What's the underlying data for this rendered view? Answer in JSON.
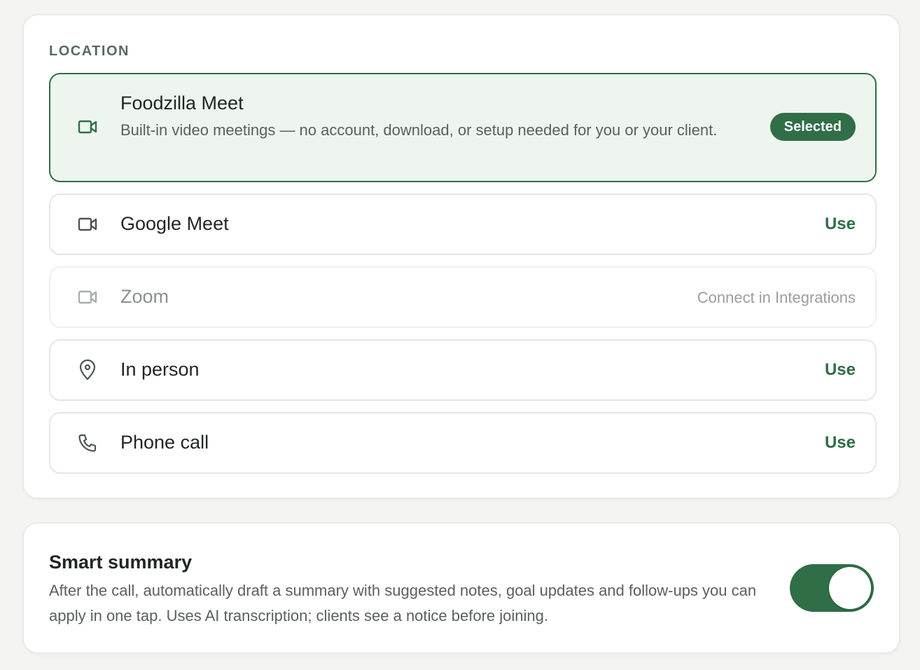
{
  "location": {
    "section_label": "LOCATION",
    "options": [
      {
        "id": "foodzilla-meet",
        "icon": "video-camera-icon",
        "title": "Foodzilla Meet",
        "description": "Built-in video meetings — no account, download, or setup needed for you or your client.",
        "state": "selected",
        "action_label": "Selected"
      },
      {
        "id": "google-meet",
        "icon": "video-camera-icon",
        "title": "Google Meet",
        "state": "available",
        "action_label": "Use"
      },
      {
        "id": "zoom",
        "icon": "video-camera-icon",
        "title": "Zoom",
        "state": "disabled",
        "action_label": "Connect in Integrations"
      },
      {
        "id": "in-person",
        "icon": "map-pin-icon",
        "title": "In person",
        "state": "available",
        "action_label": "Use"
      },
      {
        "id": "phone-call",
        "icon": "phone-icon",
        "title": "Phone call",
        "state": "available",
        "action_label": "Use"
      }
    ]
  },
  "smart_summary": {
    "title": "Smart summary",
    "description": "After the call, automatically draft a summary with suggested notes, goal updates and follow-ups you can apply in one tap. Uses AI transcription; clients see a notice before joining.",
    "enabled": true
  },
  "colors": {
    "accent": "#2f6e46",
    "selected_bg": "#eef5ef",
    "page_bg": "#f4f5f2",
    "muted_text": "#9aa09b"
  }
}
